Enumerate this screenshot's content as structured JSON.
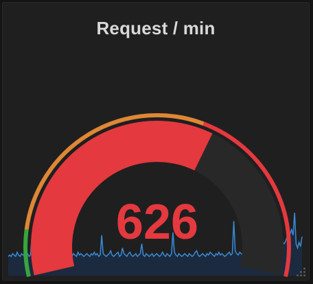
{
  "panel": {
    "title": "Request / min"
  },
  "gauge": {
    "value": 626,
    "value_text": "626",
    "min": 0,
    "max": 1000,
    "thresholds": [
      {
        "from": 0,
        "to": 100,
        "color": "#37a53f"
      },
      {
        "from": 100,
        "to": 600,
        "color": "#df8735"
      },
      {
        "from": 600,
        "to": 1000,
        "color": "#e4393e"
      }
    ],
    "fill_color": "#e4393e",
    "track_color": "#282829"
  },
  "sparkline": {
    "line_color": "#3a8bd6",
    "fill_color": "#1b2a3e",
    "values": [
      3,
      4,
      3,
      5,
      4,
      3,
      6,
      4,
      3,
      5,
      4,
      3,
      4,
      5,
      3,
      4,
      18,
      5,
      4,
      3,
      5,
      4,
      3,
      4,
      5,
      4,
      3,
      4,
      6,
      5,
      4,
      3,
      20,
      6,
      4,
      3,
      5,
      4,
      3,
      4,
      5,
      3,
      4,
      3,
      5,
      4,
      3,
      6,
      4,
      5,
      4,
      3,
      4,
      5,
      4,
      3,
      5,
      4,
      6,
      4,
      5,
      3,
      4,
      18,
      5,
      4,
      3,
      4,
      5,
      7,
      4,
      3,
      4,
      5,
      6,
      3,
      4,
      9,
      5,
      4,
      3,
      5,
      6,
      4,
      3,
      4,
      5,
      3,
      4,
      5,
      12,
      4,
      3,
      5,
      4,
      3,
      4,
      5,
      3,
      4,
      5,
      4,
      3,
      4,
      6,
      4,
      3,
      5,
      4,
      3,
      5,
      20,
      6,
      4,
      3,
      5,
      4,
      3,
      4,
      5,
      4,
      3,
      5,
      4,
      3,
      4,
      6,
      7,
      4,
      3,
      4,
      5,
      4,
      3,
      5,
      4,
      6,
      5,
      4,
      3,
      5,
      4,
      6,
      4,
      5,
      4,
      3,
      4,
      5,
      6,
      4,
      5,
      28,
      7,
      5,
      4,
      6,
      5,
      4,
      7,
      5,
      6,
      4,
      5,
      3,
      8,
      6,
      5,
      4,
      7,
      6,
      5,
      8,
      6,
      7,
      9,
      8,
      10,
      11,
      9,
      10,
      14,
      12,
      11,
      15,
      13,
      12,
      14,
      17,
      16,
      19,
      22,
      18,
      34,
      12,
      9,
      13,
      10,
      17
    ]
  }
}
